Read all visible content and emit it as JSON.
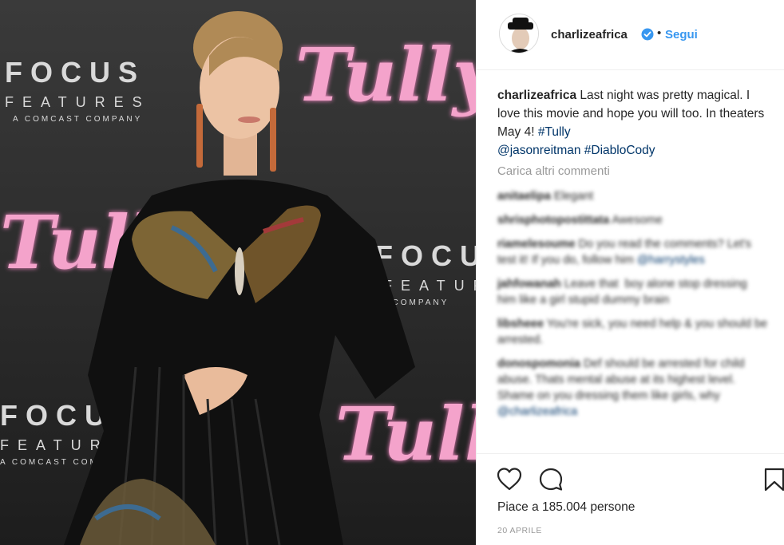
{
  "photo": {
    "backdrop": {
      "focus": "FOCUS",
      "features": "FEATURES",
      "comcast": "A COMCAST COMPANY",
      "tully": "Tully"
    }
  },
  "header": {
    "username": "charlizeafrica",
    "separator": "•",
    "follow_label": "Segui"
  },
  "caption": {
    "username": "charlizeafrica",
    "text": " Last night was pretty magical. I love this movie and hope you will too. In theaters May 4! ",
    "hashtag1": "#Tully",
    "mention": "@jasonreitman",
    "hashtag2": "#DiabloCody"
  },
  "load_more": "Carica altri commenti",
  "comments": [
    {
      "user": "anitaelipa",
      "text": " Elegant",
      "extra": ""
    },
    {
      "user": "shrisphotopostittata",
      "text": " Awesome",
      "extra": ""
    },
    {
      "user": "riamelesoume",
      "text": " Do you read the comments? Let's test it! If you do, follow him",
      "extra": "@harrystyles"
    },
    {
      "user": "jahfowanah",
      "text": " Leave that  boy alone stop dressing him like a girl stupid dummy brain",
      "extra": ""
    },
    {
      "user": "libsheee",
      "text": " You're sick, you need help & you should be arrested.",
      "extra": ""
    },
    {
      "user": "donospomonia",
      "text": " Def should be arrested for child abuse. Thats mental abuse at its highest level. Shame on you dressing them like girls, why",
      "extra": "@charlizeafrica"
    }
  ],
  "actions": {
    "likes_text": "Piace a 185.004 persone",
    "date": "20 APRILE"
  },
  "colors": {
    "link_blue": "#3897f0",
    "tag_blue": "#003569",
    "muted_gray": "#999999",
    "text": "#262626",
    "tully_pink": "#f4a3cb"
  },
  "icons": [
    "verified-badge-icon",
    "heart-icon",
    "comment-icon",
    "bookmark-icon"
  ]
}
